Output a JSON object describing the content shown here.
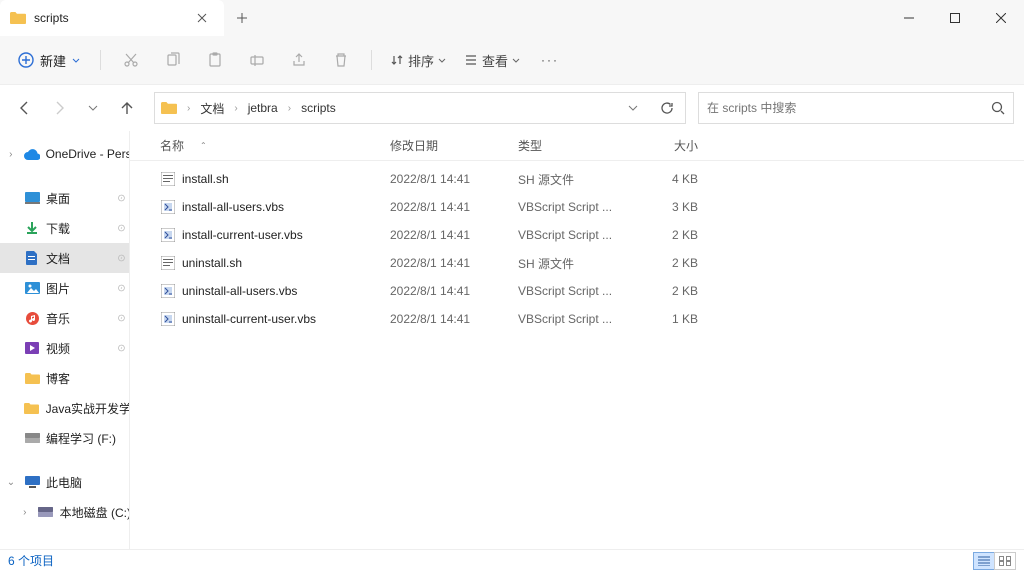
{
  "tab": {
    "title": "scripts"
  },
  "toolbar": {
    "new_label": "新建",
    "sort_label": "排序",
    "view_label": "查看"
  },
  "breadcrumbs": [
    "文档",
    "jetbra",
    "scripts"
  ],
  "search": {
    "placeholder": "在 scripts 中搜索"
  },
  "columns": {
    "name": "名称",
    "date": "修改日期",
    "type": "类型",
    "size": "大小"
  },
  "sidebar": {
    "onedrive": "OneDrive - Pers",
    "quick": [
      {
        "label": "桌面"
      },
      {
        "label": "下载"
      },
      {
        "label": "文档",
        "selected": true
      },
      {
        "label": "图片"
      },
      {
        "label": "音乐"
      },
      {
        "label": "视频"
      },
      {
        "label": "博客"
      },
      {
        "label": "Java实战开发学"
      },
      {
        "label": "编程学习 (F:)"
      }
    ],
    "thispc": "此电脑",
    "disk": "本地磁盘 (C:)"
  },
  "files": [
    {
      "name": "install.sh",
      "date": "2022/8/1 14:41",
      "type": "SH 源文件",
      "size": "4 KB",
      "icon": "sh"
    },
    {
      "name": "install-all-users.vbs",
      "date": "2022/8/1 14:41",
      "type": "VBScript Script ...",
      "size": "3 KB",
      "icon": "vbs"
    },
    {
      "name": "install-current-user.vbs",
      "date": "2022/8/1 14:41",
      "type": "VBScript Script ...",
      "size": "2 KB",
      "icon": "vbs"
    },
    {
      "name": "uninstall.sh",
      "date": "2022/8/1 14:41",
      "type": "SH 源文件",
      "size": "2 KB",
      "icon": "sh"
    },
    {
      "name": "uninstall-all-users.vbs",
      "date": "2022/8/1 14:41",
      "type": "VBScript Script ...",
      "size": "2 KB",
      "icon": "vbs"
    },
    {
      "name": "uninstall-current-user.vbs",
      "date": "2022/8/1 14:41",
      "type": "VBScript Script ...",
      "size": "1 KB",
      "icon": "vbs"
    }
  ],
  "status": {
    "count_text": "6 个项目"
  }
}
